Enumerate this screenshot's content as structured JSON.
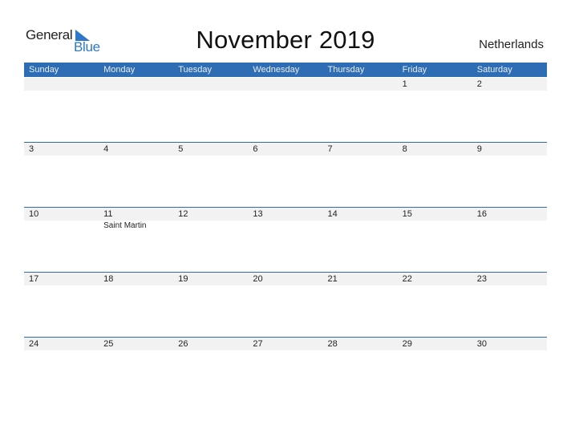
{
  "logo": {
    "word1": "General",
    "word2": "Blue",
    "icon": "triangle-flag-icon"
  },
  "title": "November 2019",
  "country": "Netherlands",
  "colors": {
    "header": "#2E6DB4",
    "strip": "#F2F2F2",
    "accent": "#2F77C9"
  },
  "days_of_week": [
    "Sunday",
    "Monday",
    "Tuesday",
    "Wednesday",
    "Thursday",
    "Friday",
    "Saturday"
  ],
  "weeks": [
    {
      "dates": [
        "",
        "",
        "",
        "",
        "",
        "1",
        "2"
      ],
      "events": [
        "",
        "",
        "",
        "",
        "",
        "",
        ""
      ]
    },
    {
      "dates": [
        "3",
        "4",
        "5",
        "6",
        "7",
        "8",
        "9"
      ],
      "events": [
        "",
        "",
        "",
        "",
        "",
        "",
        ""
      ]
    },
    {
      "dates": [
        "10",
        "11",
        "12",
        "13",
        "14",
        "15",
        "16"
      ],
      "events": [
        "",
        "Saint Martin",
        "",
        "",
        "",
        "",
        ""
      ]
    },
    {
      "dates": [
        "17",
        "18",
        "19",
        "20",
        "21",
        "22",
        "23"
      ],
      "events": [
        "",
        "",
        "",
        "",
        "",
        "",
        ""
      ]
    },
    {
      "dates": [
        "24",
        "25",
        "26",
        "27",
        "28",
        "29",
        "30"
      ],
      "events": [
        "",
        "",
        "",
        "",
        "",
        "",
        ""
      ]
    }
  ]
}
